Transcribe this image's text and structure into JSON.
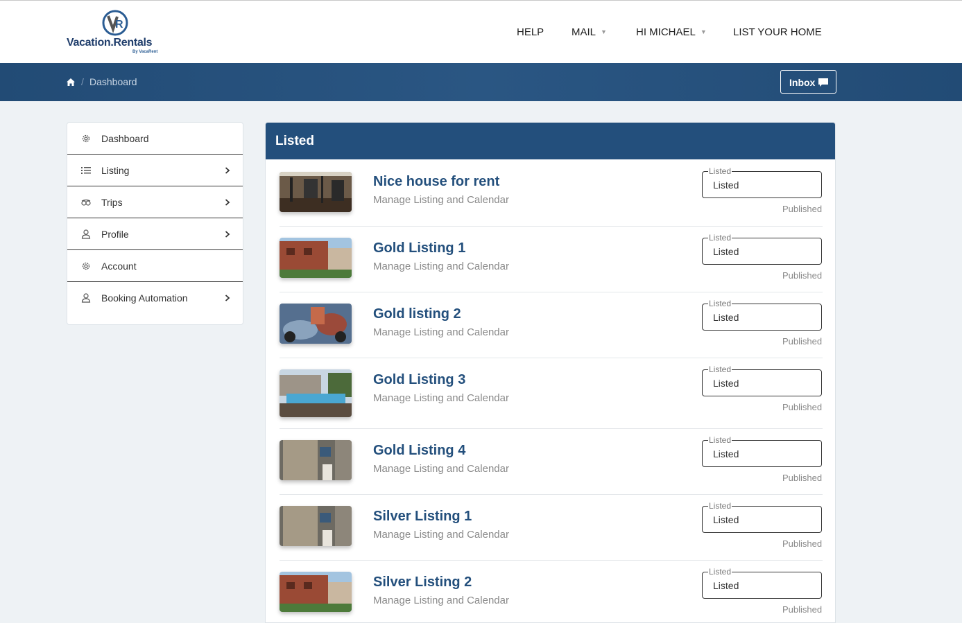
{
  "header": {
    "brand": "Vacation.Rentals",
    "brand_sub": "By VacaRent",
    "nav": [
      {
        "label": "HELP",
        "has_dropdown": false
      },
      {
        "label": "MAIL",
        "has_dropdown": true
      },
      {
        "label": "HI MICHAEL",
        "has_dropdown": true
      },
      {
        "label": "LIST YOUR HOME",
        "has_dropdown": false
      }
    ]
  },
  "breadcrumb": {
    "home_icon": "home-icon",
    "separator": "/",
    "current": "Dashboard"
  },
  "inbox": {
    "label": "Inbox",
    "icon": "chat-icon"
  },
  "sidebar": {
    "items": [
      {
        "label": "Dashboard",
        "icon": "gear-icon",
        "has_arrow": false
      },
      {
        "label": "Listing",
        "icon": "list-icon",
        "has_arrow": true
      },
      {
        "label": "Trips",
        "icon": "tripadvisor-icon",
        "has_arrow": true
      },
      {
        "label": "Profile",
        "icon": "user-icon",
        "has_arrow": true
      },
      {
        "label": "Account",
        "icon": "gear-icon",
        "has_arrow": false
      },
      {
        "label": "Booking Automation",
        "icon": "user-icon",
        "has_arrow": true
      }
    ]
  },
  "panel": {
    "title": "Listed",
    "listings": [
      {
        "title": "Nice house for rent",
        "subtitle": "Manage Listing and Calendar",
        "status_legend": "Listed",
        "status_value": "Listed",
        "publish_state": "Published",
        "thumb": "gym"
      },
      {
        "title": "Gold Listing 1",
        "subtitle": "Manage Listing and Calendar",
        "status_legend": "Listed",
        "status_value": "Listed",
        "publish_state": "Published",
        "thumb": "building"
      },
      {
        "title": "Gold listing 2",
        "subtitle": "Manage Listing and Calendar",
        "status_legend": "Listed",
        "status_value": "Listed",
        "publish_state": "Published",
        "thumb": "motorcycle"
      },
      {
        "title": "Gold Listing 3",
        "subtitle": "Manage Listing and Calendar",
        "status_legend": "Listed",
        "status_value": "Listed",
        "publish_state": "Published",
        "thumb": "pool"
      },
      {
        "title": "Gold Listing 4",
        "subtitle": "Manage Listing and Calendar",
        "status_legend": "Listed",
        "status_value": "Listed",
        "publish_state": "Published",
        "thumb": "bathroom"
      },
      {
        "title": "Silver Listing 1",
        "subtitle": "Manage Listing and Calendar",
        "status_legend": "Listed",
        "status_value": "Listed",
        "publish_state": "Published",
        "thumb": "bathroom"
      },
      {
        "title": "Silver Listing 2",
        "subtitle": "Manage Listing and Calendar",
        "status_legend": "Listed",
        "status_value": "Listed",
        "publish_state": "Published",
        "thumb": "building"
      }
    ]
  },
  "colors": {
    "brand_blue": "#234f7c",
    "page_bg": "#eef2f5",
    "muted_text": "#8a8a8a"
  }
}
